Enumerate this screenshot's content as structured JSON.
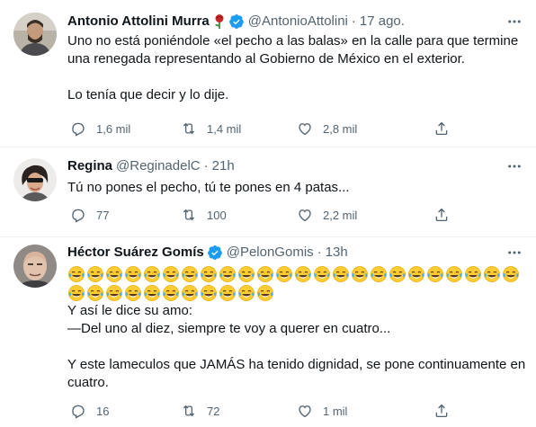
{
  "tweets": [
    {
      "name": "Antonio Attolini Murra",
      "handle": "@AntonioAttolini",
      "time": "17 ago.",
      "verified": true,
      "lines": [
        "Uno no está poniéndole «el pecho a las balas» en la calle para que termine",
        "una renegada representando al Gobierno de México en el exterior.",
        "",
        "Lo tenía que decir y lo dije."
      ],
      "replies": "1,6 mil",
      "retweets": "1,4 mil",
      "likes": "2,8 mil"
    },
    {
      "name": "Regina",
      "handle": "@ReginadelC",
      "time": "21h",
      "verified": false,
      "lines": [
        "Tú no pones el pecho, tú te pones en 4 patas..."
      ],
      "replies": "77",
      "retweets": "100",
      "likes": "2,2 mil"
    },
    {
      "name": "Héctor Suárez Gomís",
      "handle": "@PelonGomis",
      "time": "13h",
      "verified": true,
      "emoji": "face-with-tears-of-joy",
      "emoji_rows": [
        24,
        11
      ],
      "lines": [
        "Y así le dice su amo:",
        "—Del uno al diez, siempre te voy a querer en cuatro...",
        "",
        "Y este lameculos que JAMÁS ha tenido dignidad, se pone continuamente en",
        "cuatro."
      ],
      "replies": "16",
      "retweets": "72",
      "likes": "1 mil"
    }
  ],
  "dot": "·",
  "colors": {
    "verified": "#1d9bf0",
    "muted": "#536471",
    "text": "#0f1419",
    "divider": "#eff3f4"
  }
}
